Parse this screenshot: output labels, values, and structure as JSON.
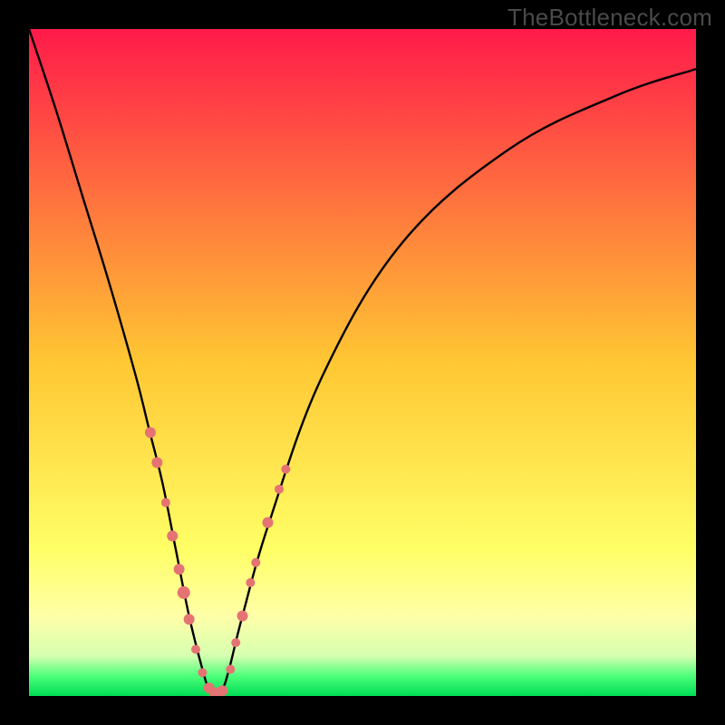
{
  "watermark": "TheBottleneck.com",
  "chart_data": {
    "type": "line",
    "title": "",
    "xlabel": "",
    "ylabel": "",
    "xlim": [
      0,
      100
    ],
    "ylim": [
      0,
      100
    ],
    "legend": false,
    "grid": false,
    "background_gradient": {
      "stops": [
        {
          "offset": 0.0,
          "color": "#ff1a4a"
        },
        {
          "offset": 0.5,
          "color": "#ffc733"
        },
        {
          "offset": 0.78,
          "color": "#ffff66"
        },
        {
          "offset": 0.88,
          "color": "#ffffa8"
        },
        {
          "offset": 0.94,
          "color": "#d6ffb0"
        },
        {
          "offset": 0.97,
          "color": "#4dff7a"
        },
        {
          "offset": 1.0,
          "color": "#00dd55"
        }
      ]
    },
    "series": [
      {
        "name": "bottleneck-curve",
        "x": [
          0,
          4,
          8,
          12,
          16,
          18,
          20,
          22,
          24,
          26,
          27,
          28,
          29,
          30,
          32,
          36,
          44,
          56,
          72,
          88,
          100
        ],
        "y": [
          100,
          88,
          75,
          62,
          48,
          40,
          32,
          22,
          12,
          4,
          1,
          0,
          1,
          4,
          12,
          26,
          48,
          68,
          82,
          90,
          94
        ]
      }
    ],
    "markers": {
      "name": "highlight-dots",
      "color": "#e57373",
      "size_range": [
        4,
        8
      ],
      "points": [
        {
          "x": 18.2,
          "y": 39.5,
          "r": 6
        },
        {
          "x": 19.2,
          "y": 35.0,
          "r": 6
        },
        {
          "x": 20.5,
          "y": 29.0,
          "r": 5
        },
        {
          "x": 21.5,
          "y": 24.0,
          "r": 6
        },
        {
          "x": 22.5,
          "y": 19.0,
          "r": 6
        },
        {
          "x": 23.2,
          "y": 15.5,
          "r": 7
        },
        {
          "x": 24.0,
          "y": 11.5,
          "r": 6
        },
        {
          "x": 25.0,
          "y": 7.0,
          "r": 5
        },
        {
          "x": 26.0,
          "y": 3.5,
          "r": 5
        },
        {
          "x": 27.0,
          "y": 1.2,
          "r": 6
        },
        {
          "x": 28.0,
          "y": 0.3,
          "r": 7
        },
        {
          "x": 29.0,
          "y": 0.8,
          "r": 6
        },
        {
          "x": 30.2,
          "y": 4.0,
          "r": 5
        },
        {
          "x": 31.0,
          "y": 8.0,
          "r": 5
        },
        {
          "x": 32.0,
          "y": 12.0,
          "r": 6
        },
        {
          "x": 33.2,
          "y": 17.0,
          "r": 5
        },
        {
          "x": 34.0,
          "y": 20.0,
          "r": 5
        },
        {
          "x": 35.8,
          "y": 26.0,
          "r": 6
        },
        {
          "x": 37.5,
          "y": 31.0,
          "r": 5
        },
        {
          "x": 38.5,
          "y": 34.0,
          "r": 5
        }
      ]
    }
  }
}
